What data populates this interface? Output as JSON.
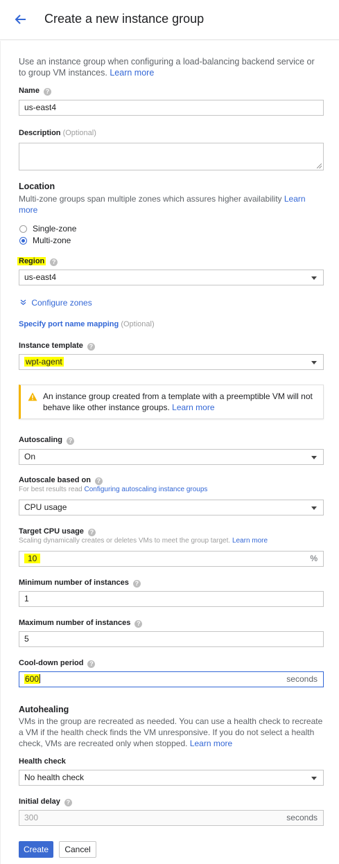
{
  "header": {
    "title": "Create a new instance group"
  },
  "intro": {
    "text": "Use an instance group when configuring a load-balancing backend service or to group VM instances.",
    "learn_more": "Learn more"
  },
  "name": {
    "label": "Name",
    "value": "us-east4"
  },
  "description": {
    "label": "Description",
    "optional": "(Optional)",
    "value": ""
  },
  "location": {
    "title": "Location",
    "desc": "Multi-zone groups span multiple zones which assures higher availability",
    "learn_more": "Learn more",
    "options": [
      "Single-zone",
      "Multi-zone"
    ],
    "selected": "Multi-zone"
  },
  "region": {
    "label": "Region",
    "value": "us-east4"
  },
  "configure_zones": "Configure zones",
  "port_mapping": {
    "link": "Specify port name mapping",
    "optional": "(Optional)"
  },
  "instance_template": {
    "label": "Instance template",
    "value": "wpt-agent"
  },
  "warning": {
    "text": "An instance group created from a template with a preemptible VM will not behave like other instance groups.",
    "learn_more": "Learn more"
  },
  "autoscaling": {
    "label": "Autoscaling",
    "value": "On"
  },
  "autoscale_based_on": {
    "label": "Autoscale based on",
    "hint_prefix": "For best results read",
    "hint_link": "Configuring autoscaling instance groups",
    "value": "CPU usage"
  },
  "target_cpu": {
    "label": "Target CPU usage",
    "hint": "Scaling dynamically creates or deletes VMs to meet the group target.",
    "hint_link": "Learn more",
    "value": "10",
    "suffix": "%"
  },
  "min_instances": {
    "label": "Minimum number of instances",
    "value": "1"
  },
  "max_instances": {
    "label": "Maximum number of instances",
    "value": "5"
  },
  "cooldown": {
    "label": "Cool-down period",
    "value": "600",
    "suffix": "seconds"
  },
  "autohealing": {
    "title": "Autohealing",
    "desc": "VMs in the group are recreated as needed. You can use a health check to recreate a VM if the health check finds the VM unresponsive. If you do not select a health check, VMs are recreated only when stopped.",
    "learn_more": "Learn more"
  },
  "health_check": {
    "label": "Health check",
    "value": "No health check"
  },
  "initial_delay": {
    "label": "Initial delay",
    "placeholder": "300",
    "suffix": "seconds"
  },
  "buttons": {
    "create": "Create",
    "cancel": "Cancel"
  },
  "colors": {
    "accent": "#3367d6",
    "highlight": "#ffff00",
    "warning": "#f4b400"
  },
  "icons": [
    "back-arrow-icon",
    "help-icon",
    "chevron-down-icon",
    "warning-icon",
    "dropdown-arrow-icon"
  ]
}
